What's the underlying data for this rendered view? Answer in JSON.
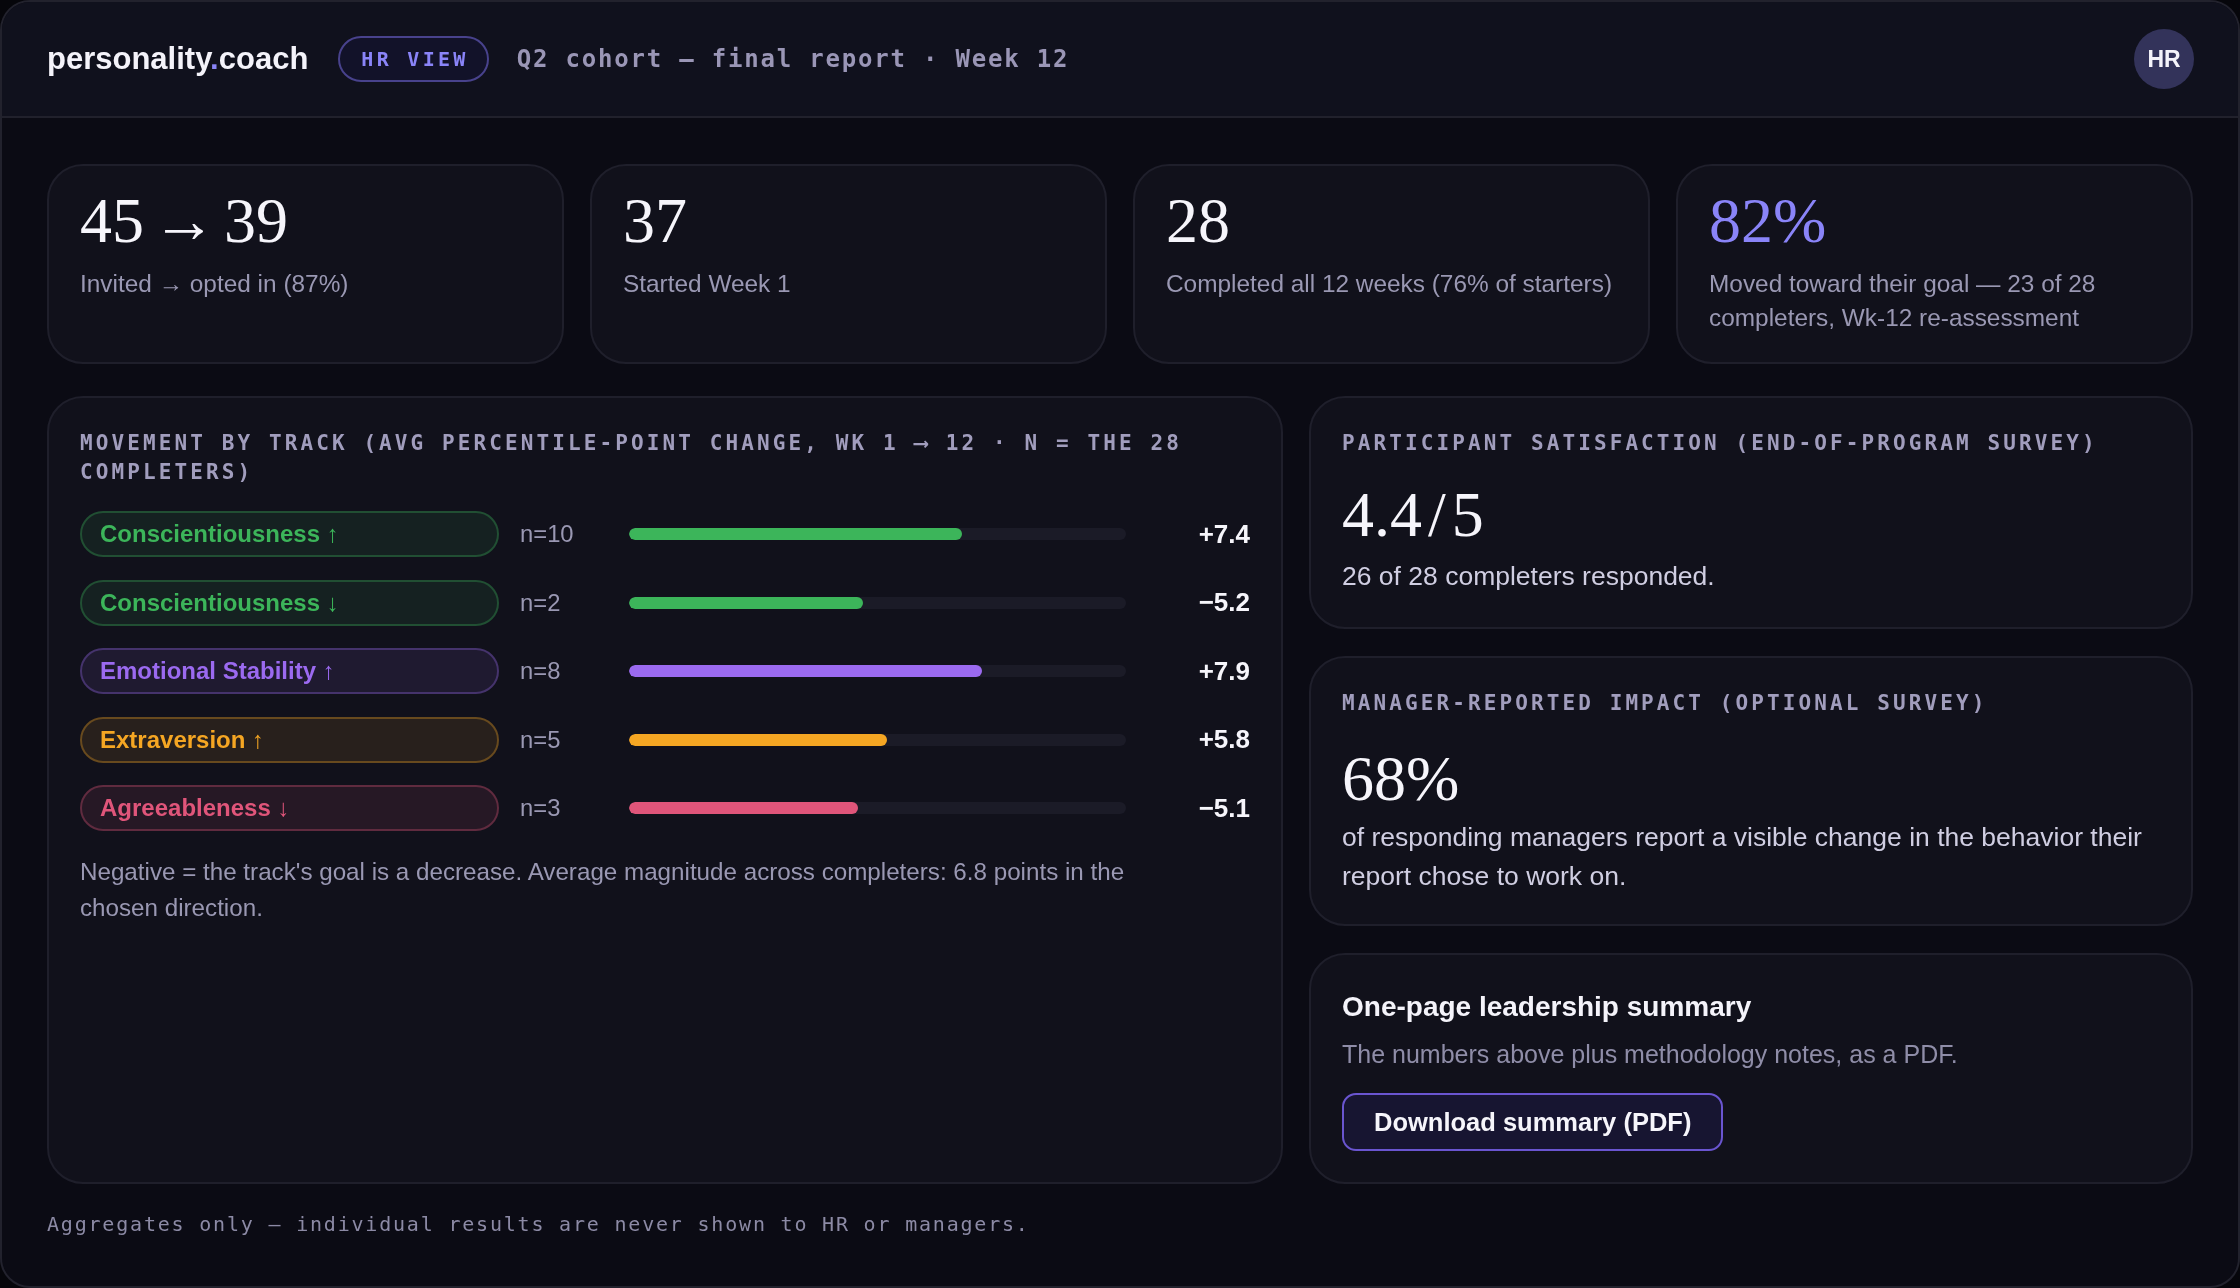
{
  "header": {
    "logo": {
      "name": "personality",
      "dot": ".",
      "suffix": "coach"
    },
    "badge": "HR VIEW",
    "subtitle": "Q2 cohort — final report · Week 12",
    "avatar": "HR"
  },
  "stats": [
    {
      "value": "45 → 39",
      "label": "Invited → opted in (87%)",
      "highlighted": false
    },
    {
      "value": "37",
      "label": "Started Week 1",
      "highlighted": false
    },
    {
      "value": "28",
      "label": "Completed all 12 weeks (76% of starters)",
      "highlighted": false
    },
    {
      "value": "82%",
      "label": "Moved toward their goal — 23 of 28 completers, Wk-12 re-assessment",
      "highlighted": true
    }
  ],
  "movement": {
    "title": "MOVEMENT BY TRACK (AVG PERCENTILE-POINT CHANGE, WK 1 ⟶ 12 · N = THE 28 COMPLETERS)",
    "tracks": [
      {
        "label": "Conscientiousness ↑",
        "color": "#3cb55a",
        "n": "n=10",
        "level": 0.67,
        "change": "+7.4"
      },
      {
        "label": "Conscientiousness ↓",
        "color": "#3cb55a",
        "n": "n=2",
        "level": 0.47,
        "change": "−5.2"
      },
      {
        "label": "Emotional Stability ↑",
        "color": "#9b6af0",
        "n": "n=8",
        "level": 0.71,
        "change": "+7.9"
      },
      {
        "label": "Extraversion ↑",
        "color": "#f5a623",
        "n": "n=5",
        "level": 0.52,
        "change": "+5.8"
      },
      {
        "label": "Agreeableness ↓",
        "color": "#e0557a",
        "n": "n=3",
        "level": 0.46,
        "change": "−5.1"
      }
    ],
    "note": "Negative = the track's goal is a decrease. Average magnitude across completers: 6.8 points in the chosen direction."
  },
  "satisfaction": {
    "title": "PARTICIPANT SATISFACTION (END-OF-PROGRAM SURVEY)",
    "value": "4.4 / 5",
    "caption": "26 of 28 completers responded."
  },
  "manager_impact": {
    "title": "MANAGER-REPORTED IMPACT (OPTIONAL SURVEY)",
    "value": "68%",
    "caption": "of responding managers report a visible change in the behavior their report chose to work on."
  },
  "summary": {
    "title": "One-page leadership summary",
    "description": "The numbers above plus methodology notes, as a PDF.",
    "button": "Download summary (PDF)"
  },
  "footer": "Aggregates only — individual results are never shown to HR or managers."
}
